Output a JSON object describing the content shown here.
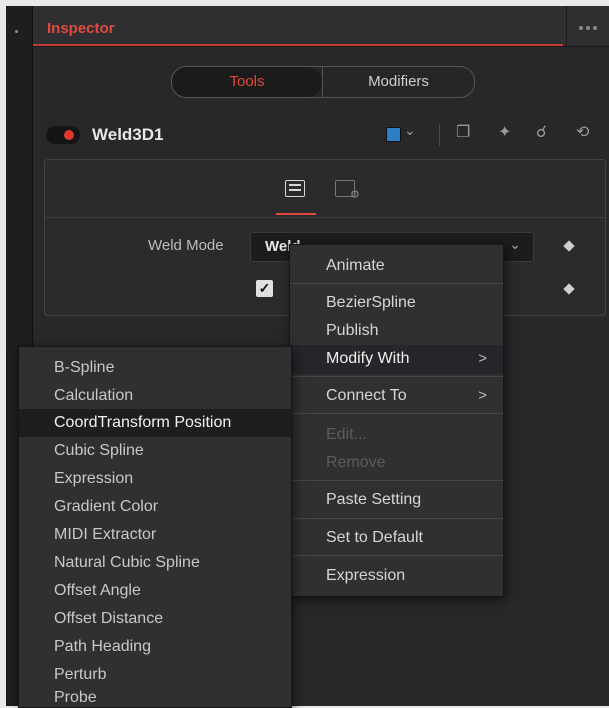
{
  "inspector": {
    "title": "Inspector"
  },
  "tabs": {
    "tools": "Tools",
    "modifiers": "Modifiers"
  },
  "node": {
    "name": "Weld3D1",
    "color": "#2b7fc4"
  },
  "controls": {
    "weld_mode_label": "Weld Mode",
    "weld_mode_value": "Weld"
  },
  "context_menu": {
    "items": [
      {
        "label": "Animate"
      },
      {
        "label": "BezierSpline"
      },
      {
        "label": "Publish"
      },
      {
        "label": "Modify With",
        "arrow": ">"
      },
      {
        "label": "Connect To",
        "arrow": ">"
      },
      {
        "label": "Edit..."
      },
      {
        "label": "Remove"
      },
      {
        "label": "Paste Setting"
      },
      {
        "label": "Set to Default"
      },
      {
        "label": "Expression"
      }
    ]
  },
  "modify_with_submenu": {
    "items": [
      "B-Spline",
      "Calculation",
      "CoordTransform Position",
      "Cubic Spline",
      "Expression",
      "Gradient Color",
      "MIDI Extractor",
      "Natural Cubic Spline",
      "Offset Angle",
      "Offset Distance",
      "Path Heading",
      "Perturb",
      "Probe"
    ]
  }
}
